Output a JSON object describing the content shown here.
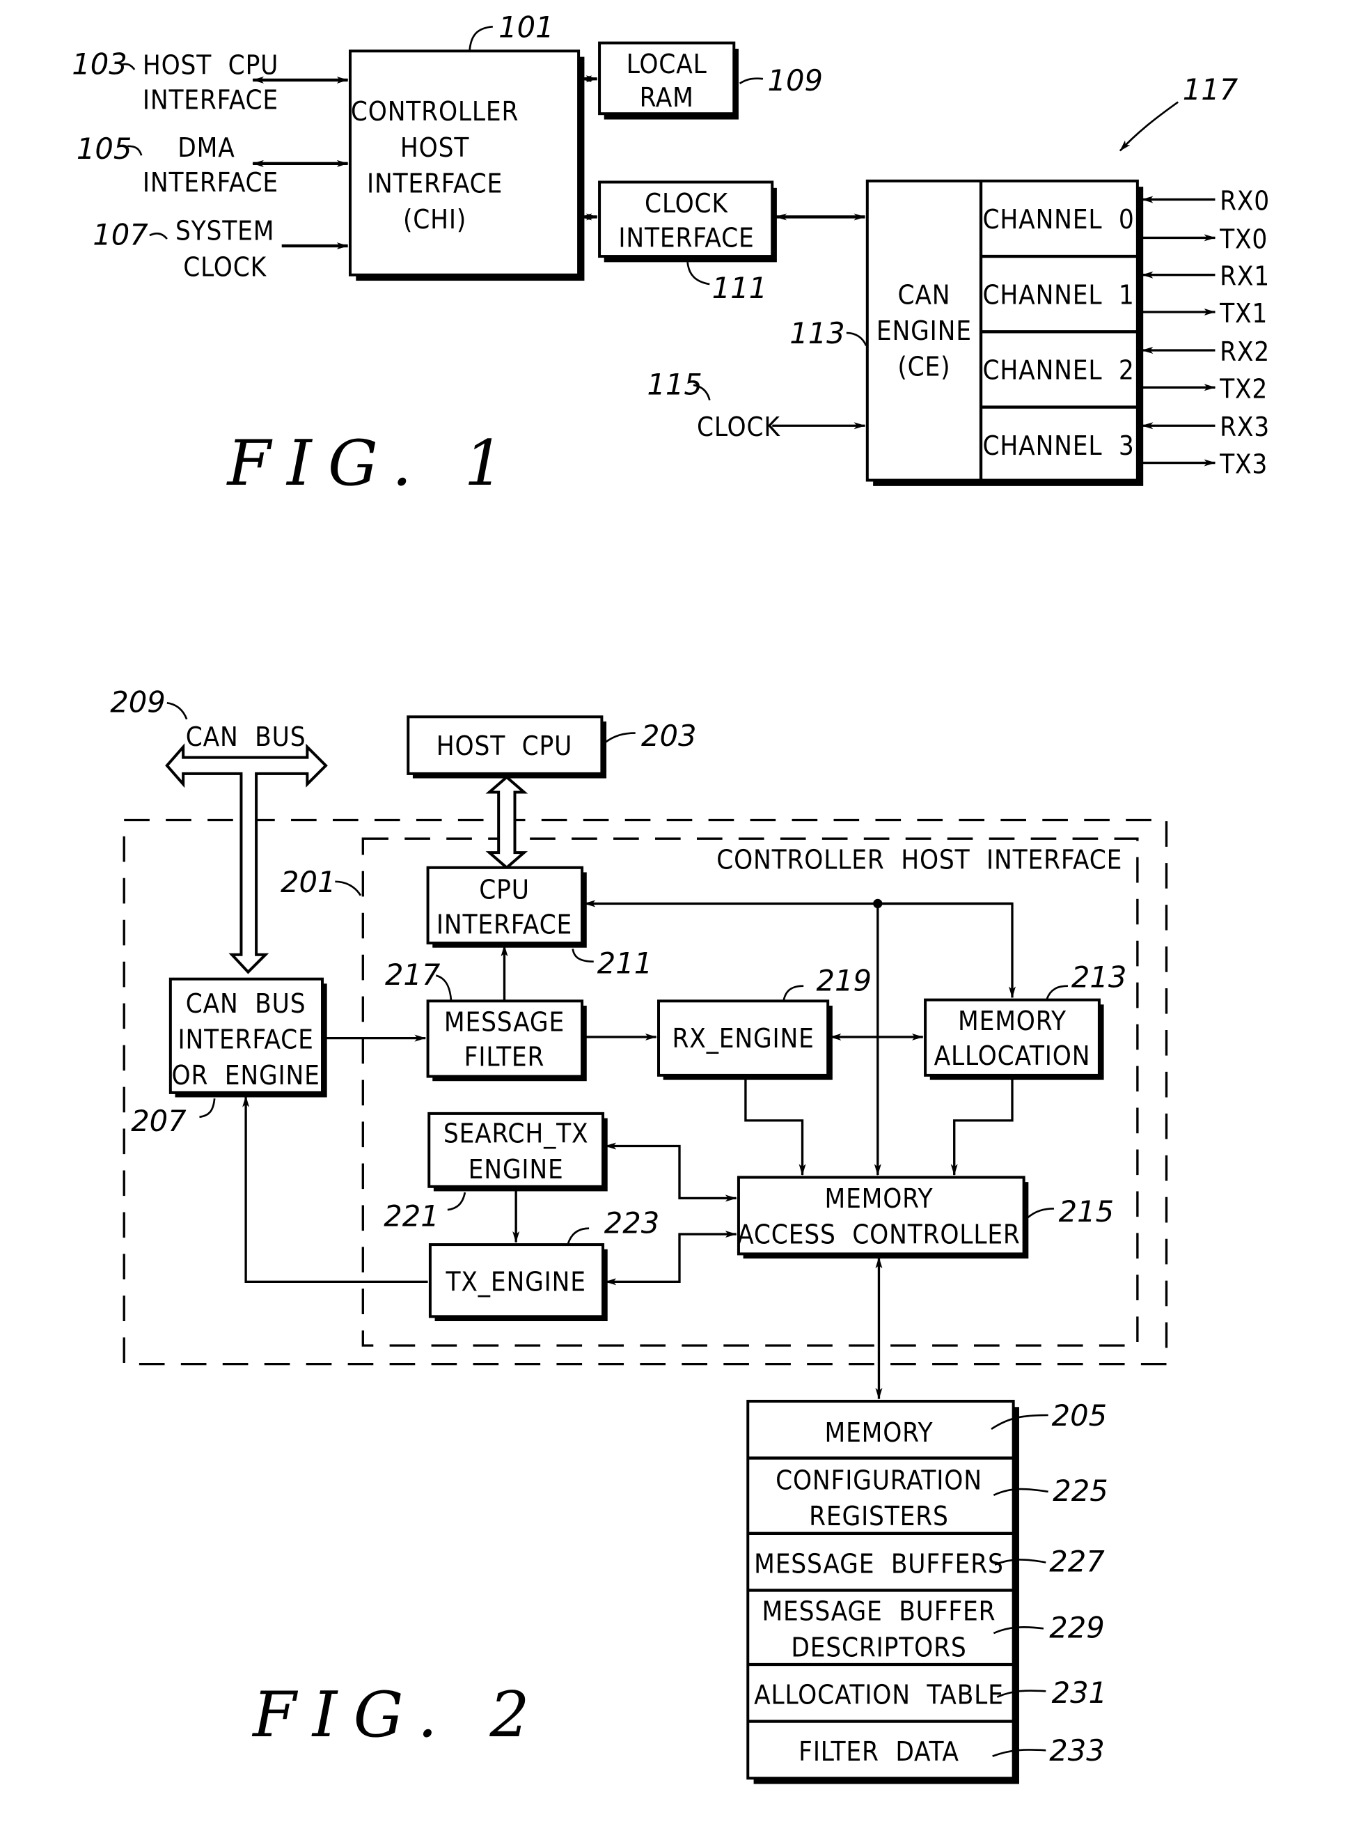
{
  "fig1": {
    "caption": "FIG. 1",
    "blocks": {
      "chi": {
        "lines": [
          "CONTROLLER",
          "HOST",
          "INTERFACE",
          "(CHI)"
        ],
        "ref": "101"
      },
      "local_ram": {
        "lines": [
          "LOCAL",
          "RAM"
        ],
        "ref": "109"
      },
      "clock_interface": {
        "lines": [
          "CLOCK",
          "INTERFACE"
        ],
        "ref": "111"
      },
      "can_engine": {
        "lines": [
          "CAN",
          "ENGINE",
          "(CE)"
        ],
        "ref": "113"
      }
    },
    "inputs": [
      {
        "ref": "103",
        "lines": [
          "HOST  CPU",
          "INTERFACE"
        ]
      },
      {
        "ref": "105",
        "lines": [
          "DMA",
          "INTERFACE"
        ]
      },
      {
        "ref": "107",
        "lines": [
          "SYSTEM",
          "CLOCK"
        ]
      }
    ],
    "clock": {
      "ref": "115",
      "label": "CLOCK"
    },
    "channel_group_ref": "117",
    "channels": [
      {
        "label": "CHANNEL  0",
        "rx": "RX0",
        "tx": "TX0"
      },
      {
        "label": "CHANNEL  1",
        "rx": "RX1",
        "tx": "TX1"
      },
      {
        "label": "CHANNEL  2",
        "rx": "RX2",
        "tx": "TX2"
      },
      {
        "label": "CHANNEL  3",
        "rx": "RX3",
        "tx": "TX3"
      }
    ]
  },
  "fig2": {
    "caption": "FIG. 2",
    "region_label": "CONTROLLER  HOST  INTERFACE",
    "region_ref": "201",
    "can_bus": {
      "label": "CAN  BUS",
      "ref": "209"
    },
    "blocks": {
      "host_cpu": {
        "lines": [
          "HOST  CPU"
        ],
        "ref": "203"
      },
      "cpu_interface": {
        "lines": [
          "CPU",
          "INTERFACE"
        ],
        "ref": "211"
      },
      "can_bus_interface": {
        "lines": [
          "CAN  BUS",
          "INTERFACE",
          "OR  ENGINE"
        ],
        "ref": "207"
      },
      "message_filter": {
        "lines": [
          "MESSAGE",
          "FILTER"
        ],
        "ref": "217"
      },
      "rx_engine": {
        "lines": [
          "RX_ENGINE"
        ],
        "ref": "219"
      },
      "memory_allocation": {
        "lines": [
          "MEMORY",
          "ALLOCATION"
        ],
        "ref": "213"
      },
      "search_tx_engine": {
        "lines": [
          "SEARCH_TX",
          "ENGINE"
        ],
        "ref": "221"
      },
      "tx_engine": {
        "lines": [
          "TX_ENGINE"
        ],
        "ref": "223"
      },
      "memory_access_controller": {
        "lines": [
          "MEMORY",
          "ACCESS  CONTROLLER"
        ],
        "ref": "215"
      }
    },
    "memory_stack": [
      {
        "lines": [
          "MEMORY"
        ],
        "ref": "205"
      },
      {
        "lines": [
          "CONFIGURATION",
          "REGISTERS"
        ],
        "ref": "225"
      },
      {
        "lines": [
          "MESSAGE  BUFFERS"
        ],
        "ref": "227"
      },
      {
        "lines": [
          "MESSAGE  BUFFER",
          "DESCRIPTORS"
        ],
        "ref": "229"
      },
      {
        "lines": [
          "ALLOCATION  TABLE"
        ],
        "ref": "231"
      },
      {
        "lines": [
          "FILTER  DATA"
        ],
        "ref": "233"
      }
    ]
  }
}
